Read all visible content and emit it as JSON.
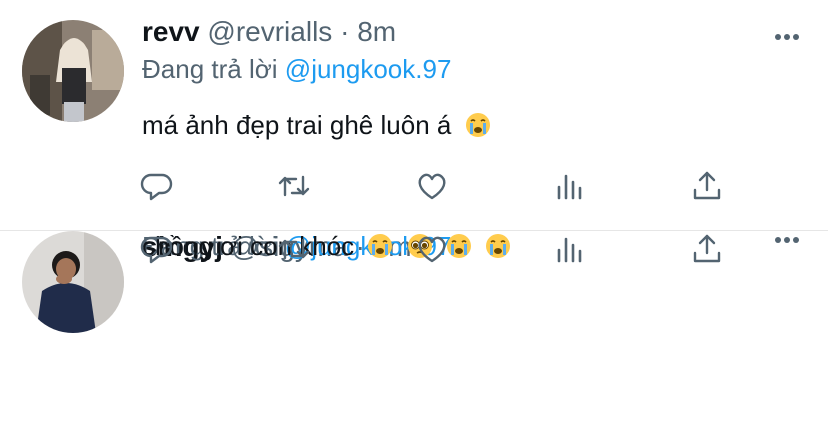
{
  "tweets": [
    {
      "name": "revv",
      "handle": "@revrialls",
      "separator": "·",
      "time": "8m",
      "reply_prefix": "Đang trả lời",
      "reply_to": "@jungkook.97",
      "text": "má ảnh đẹp trai ghê luôn á",
      "emojis": [
        "loudly-crying-face"
      ]
    },
    {
      "name": "singyj",
      "handle": "@sigyma",
      "separator": "·",
      "time": "6m",
      "reply_prefix": "Đang trả lời",
      "reply_to": "@jungkook.97",
      "text": "chồng ơi con khóc",
      "emojis": [
        "loudly-crying-face",
        "pleading-face",
        "loudly-crying-face",
        "loudly-crying-face"
      ]
    }
  ],
  "actions": [
    "reply-icon",
    "retweet-icon",
    "like-icon",
    "analytics-icon",
    "share-icon"
  ],
  "colors": {
    "accent": "#1d9bf0",
    "muted": "#536471",
    "text": "#0f1419",
    "divider": "#e6e6e6"
  }
}
